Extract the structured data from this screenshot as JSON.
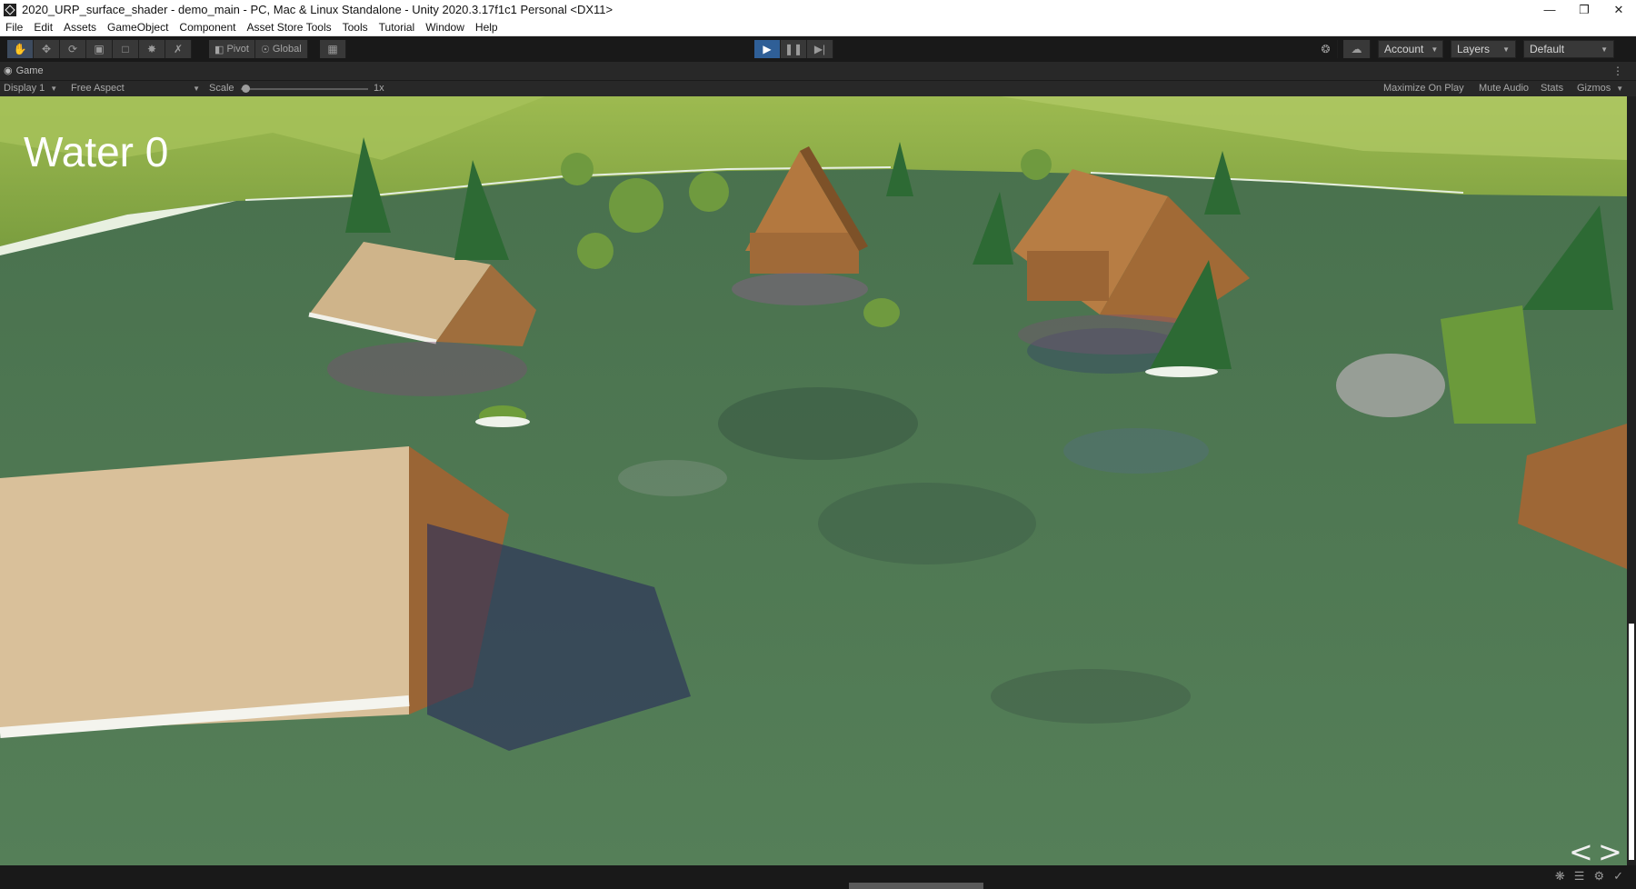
{
  "window": {
    "title": "2020_URP_surface_shader - demo_main - PC, Mac & Linux Standalone - Unity 2020.3.17f1c1 Personal <DX11>",
    "minimize_icon": "minimize-icon",
    "restore_icon": "restore-icon",
    "close_icon": "close-icon"
  },
  "menu": [
    "File",
    "Edit",
    "Assets",
    "GameObject",
    "Component",
    "Asset Store Tools",
    "Tools",
    "Tutorial",
    "Window",
    "Help"
  ],
  "toolbar": {
    "tools": [
      "hand-tool-icon",
      "move-tool-icon",
      "rotate-tool-icon",
      "scale-tool-icon",
      "rect-tool-icon",
      "transform-tool-icon",
      "custom-tool-icon"
    ],
    "pivot_label": "Pivot",
    "global_label": "Global",
    "play_icon": "play-icon",
    "pause_icon": "pause-icon",
    "step_icon": "step-icon",
    "account_label": "Account",
    "layers_label": "Layers",
    "layout_label": "Default"
  },
  "game_view": {
    "tab_label": "Game",
    "display_label": "Display 1",
    "aspect_label": "Free Aspect",
    "scale_label": "Scale",
    "scale_value": "1x",
    "scale_level": 0.0,
    "maximize_label": "Maximize On Play",
    "mute_label": "Mute Audio",
    "stats_label": "Stats",
    "gizmos_label": "Gizmos",
    "hud_text": "Water 0",
    "prev_arrow": "<",
    "next_arrow": ">"
  },
  "colors": {
    "play_active": "#2f5f97",
    "water": "#4d7a52",
    "hills": "#8bab48",
    "wood": "#b0763f",
    "tree": "#2f6a36"
  }
}
